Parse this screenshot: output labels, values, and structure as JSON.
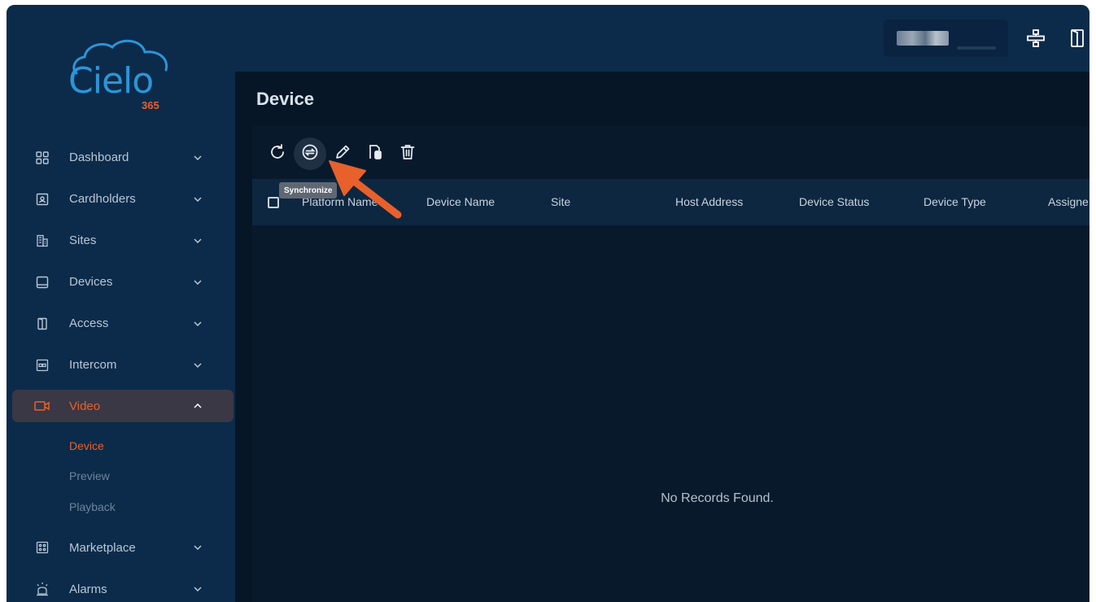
{
  "brand": {
    "name": "Cielo",
    "suffix": "365"
  },
  "sidebar": {
    "items": [
      {
        "label": "Dashboard",
        "icon": "dashboard-grid-icon",
        "expanded": false
      },
      {
        "label": "Cardholders",
        "icon": "id-card-icon",
        "expanded": false
      },
      {
        "label": "Sites",
        "icon": "building-icon",
        "expanded": false
      },
      {
        "label": "Devices",
        "icon": "monitor-icon",
        "expanded": false
      },
      {
        "label": "Access",
        "icon": "door-icon",
        "expanded": false
      },
      {
        "label": "Intercom",
        "icon": "intercom-icon",
        "expanded": false
      },
      {
        "label": "Video",
        "icon": "video-camera-icon",
        "expanded": true,
        "active": true
      },
      {
        "label": "Marketplace",
        "icon": "marketplace-icon",
        "expanded": false
      },
      {
        "label": "Alarms",
        "icon": "alarm-siren-icon",
        "expanded": false
      }
    ],
    "video_subitems": [
      {
        "label": "Device",
        "current": true
      },
      {
        "label": "Preview",
        "current": false
      },
      {
        "label": "Playback",
        "current": false
      }
    ]
  },
  "topbar": {
    "icons": [
      "network-icon",
      "logout-door-icon"
    ]
  },
  "page": {
    "title": "Device",
    "toolbar": {
      "tools": [
        "refresh-icon",
        "synchronize-icon",
        "edit-pencil-icon",
        "device-copy-icon",
        "delete-trash-icon"
      ],
      "tooltip": "Synchronize"
    },
    "table": {
      "columns": [
        "Platform Name",
        "Device Name",
        "Site",
        "Host Address",
        "Device Status",
        "Device Type",
        "Assigne"
      ],
      "rows": [],
      "empty_message": "No Records Found."
    }
  },
  "colors": {
    "accent": "#e8602c",
    "sidebar_bg": "#0c2b4a",
    "main_bg": "#061627",
    "logo_blue": "#2c95d8"
  }
}
